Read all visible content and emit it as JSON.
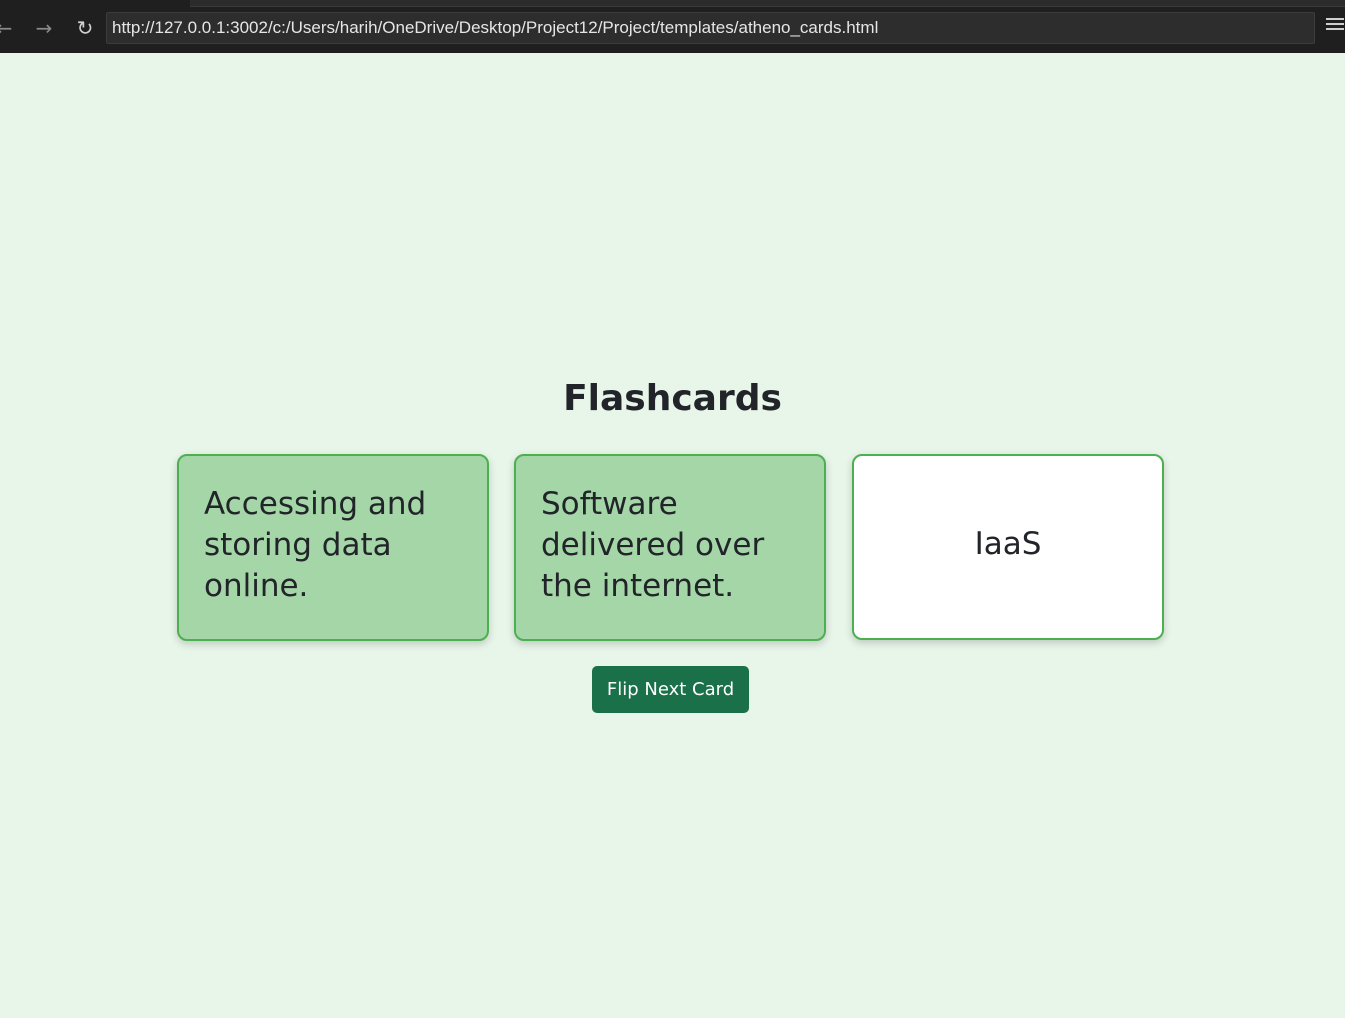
{
  "browser": {
    "url": "http://127.0.0.1:3002/c:/Users/harih/OneDrive/Desktop/Project12/Project/templates/atheno_cards.html",
    "back_icon": "←",
    "forward_icon": "→",
    "reload_icon": "↻"
  },
  "page": {
    "title": "Flashcards",
    "button_label": "Flip Next Card"
  },
  "cards": [
    {
      "text": "Accessing and storing data online.",
      "state": "back"
    },
    {
      "text": "Software delivered over the internet.",
      "state": "back"
    },
    {
      "text": "IaaS",
      "state": "front"
    }
  ],
  "colors": {
    "page_background": "#e8f5e9",
    "card_flipped": "#a5d6a7",
    "card_front": "#ffffff",
    "card_border": "#4caf50",
    "button": "#1a7048"
  }
}
